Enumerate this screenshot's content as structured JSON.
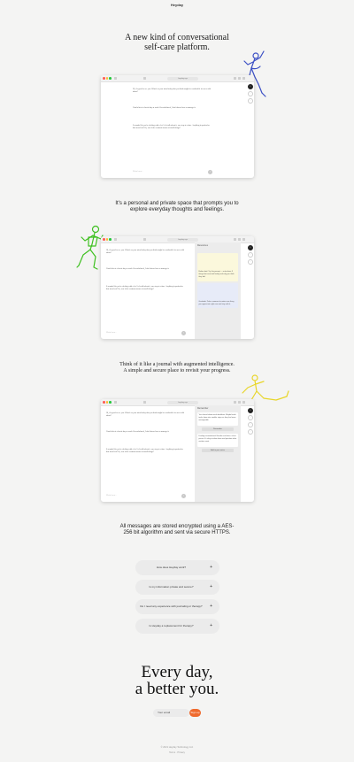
{
  "brand": "Heyday",
  "hero": {
    "title_line1": "A new kind of conversational",
    "title_line2": "self-care platform."
  },
  "section2": {
    "text_line1": "It's a personal and private space that prompts you to",
    "text_line2": "explore everyday thoughts and feelings."
  },
  "section3": {
    "text_line1": "Think of it like a journal with augmented intelligence.",
    "text_line2": "A simple and secure place to revisit your progress."
  },
  "section4": {
    "text_line1": "All messages are stored encrypted using a AES-",
    "text_line2": "256 bit algorithm and sent via secure HTTPS."
  },
  "browser": {
    "url": "heyday.xyz",
    "messages": [
      "Hi, it's good to see you. What's on your mind today that you think might be worthwhile for us to talk about?",
      "I had a bit of a hectic day at work. Overwhelmed, I don't know how to manage it.",
      "It sounds like you're dealing with a lot. Let's talk about it, one step at a time. Anything in particular that stood out? Or, was it the constant stream of small things?"
    ],
    "input_placeholder": "Write here...",
    "send_icon": "arrow-up-icon",
    "accent": "#ef6a2d"
  },
  "panel2": {
    "title": "Resources",
    "card1": "Before bed: Try this prompt — write down 3 things that went well today and why you think they did.",
    "card2": "Gratitude: Take a moment to notice one thing you appreciate right now and stay with it."
  },
  "panel3": {
    "title": "Remember",
    "card1": "You shared about work deadlines. Maybe break tasks down into smaller steps so they feel more manageable.",
    "button1": "Remember",
    "card2": "Feeling overwhelmed: Breathe and take a short pause. It's okay to slow down and prioritize what matters most.",
    "button2": "Add to your notes"
  },
  "faq": [
    {
      "question": "How does Heyday work?"
    },
    {
      "question": "Is my information private and secure?"
    },
    {
      "question": "Do I need any experience with journaling or therapy?"
    },
    {
      "question": "Is Heyday a replacement for therapy?"
    }
  ],
  "closing": {
    "line1": "Every day,",
    "line2": "a better you."
  },
  "signup": {
    "placeholder": "Your email",
    "button": "Sign up"
  },
  "footer": {
    "copyright": "© 2021 Heyday Technology Ltd.",
    "links": "Terms · Privacy"
  },
  "colors": {
    "figure_blue": "#3b4fc4",
    "figure_green": "#3fc021",
    "figure_yellow": "#e8d62a"
  }
}
